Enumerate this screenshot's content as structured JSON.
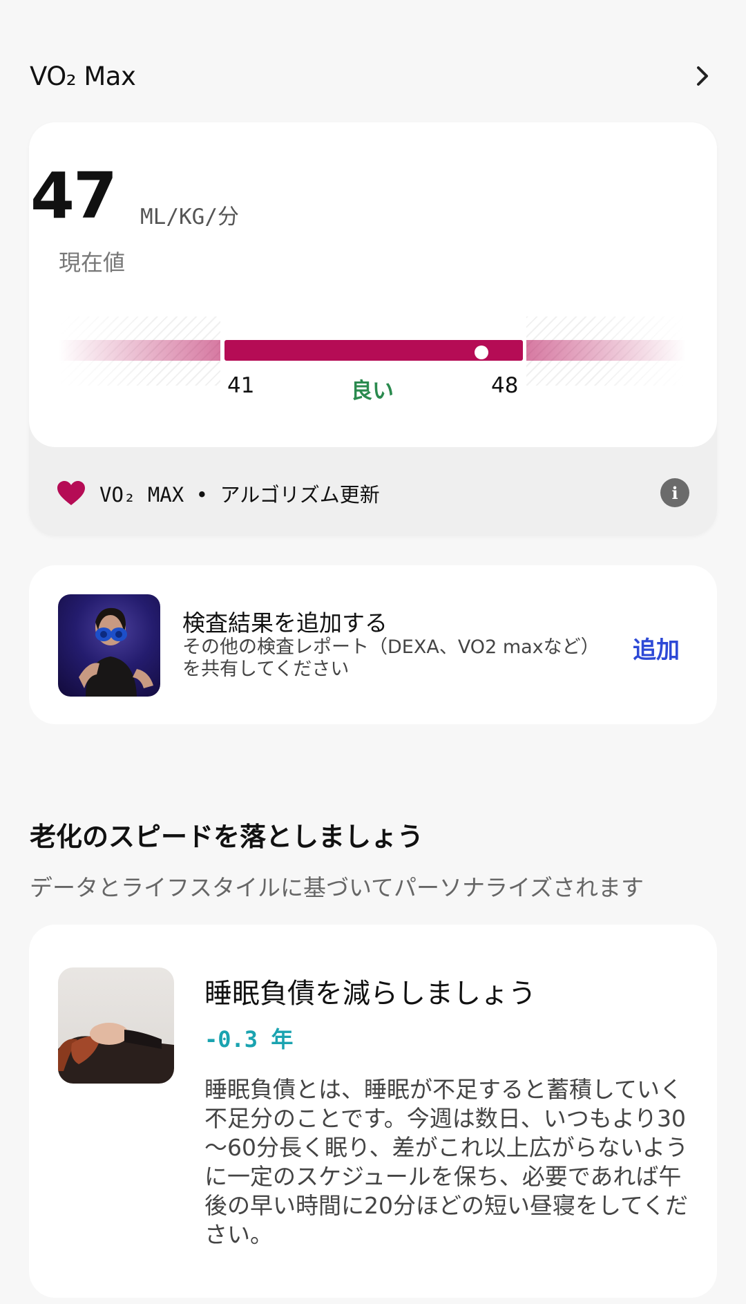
{
  "section": {
    "title": "VO₂ Max"
  },
  "metric": {
    "value": "47",
    "unit": "ML/KG/分",
    "caption": "現在値",
    "range": {
      "low": "41",
      "high": "48",
      "label": "良い",
      "current_fraction": 0.86
    },
    "source": "VO₂ MAX • アルゴリズム更新",
    "accent_color": "#b50c55",
    "status_color": "#2a8a4e"
  },
  "add_result": {
    "title": "検査結果を追加する",
    "subtitle_line1": "その他の検査レポート（DEXA、VO2 maxなど）",
    "subtitle_line2": "を共有してください",
    "button": "追加",
    "button_color": "#2d49d6"
  },
  "aging": {
    "title": "老化のスピードを落としましょう",
    "subtitle": "データとライフスタイルに基づいてパーソナライズされます",
    "tip": {
      "title": "睡眠負債を減らしましょう",
      "delta": "-0.3 年",
      "body": "睡眠負債とは、睡眠が不足すると蓄積していく不足分のことです。今週は数日、いつもより30～60分長く眠り、差がこれ以上広がらないように一定のスケジュールを保ち、必要であれば午後の早い時間に20分ほどの短い昼寝をしてください。",
      "delta_color": "#1aa3b0"
    }
  }
}
